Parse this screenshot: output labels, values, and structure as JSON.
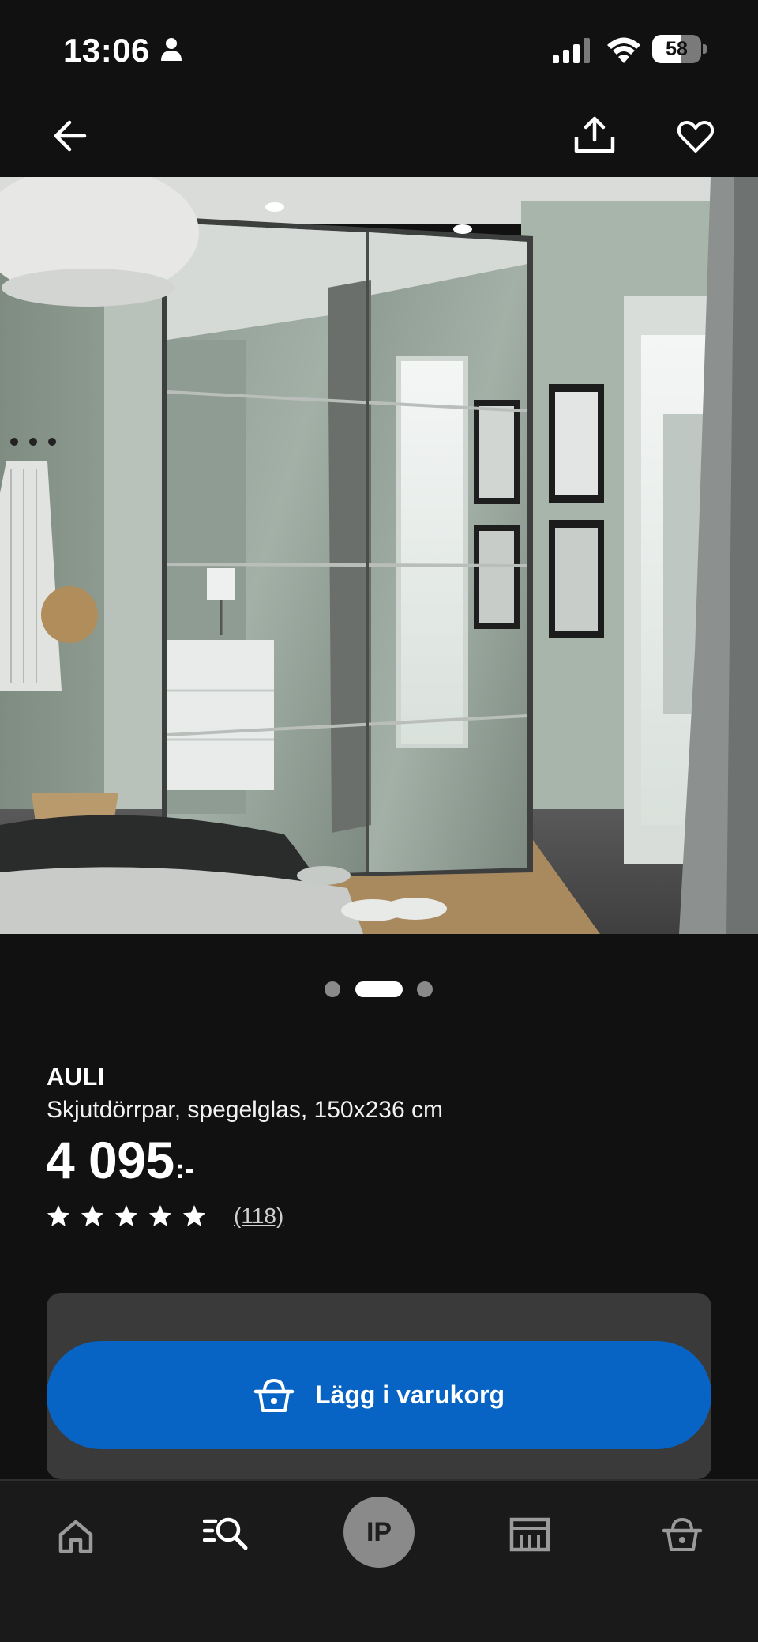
{
  "status_bar": {
    "time": "13:06",
    "battery": "58"
  },
  "icons": {
    "back": "arrow-left-icon",
    "share": "share-icon",
    "favorite": "heart-icon",
    "person": "person-icon",
    "signal": "cellular-signal-icon",
    "wifi": "wifi-icon"
  },
  "carousel": {
    "count": 3,
    "active_index": 1
  },
  "product": {
    "name": "AULI",
    "description": "Skjutdörrpar, spegelglas, 150x236 cm",
    "price_int": "4 095",
    "price_suffix": ":-",
    "rating": 5,
    "review_count": "(118)"
  },
  "cart_button": {
    "label": "Lägg i varukorg"
  },
  "bottom_nav": {
    "profile_initials": "IP",
    "items": [
      "home-icon",
      "search-list-icon",
      "profile-avatar",
      "store-icon",
      "cart-icon"
    ]
  },
  "colors": {
    "background": "#111111",
    "primary_blue": "#0864c4",
    "panel": "#3a3a3a"
  }
}
